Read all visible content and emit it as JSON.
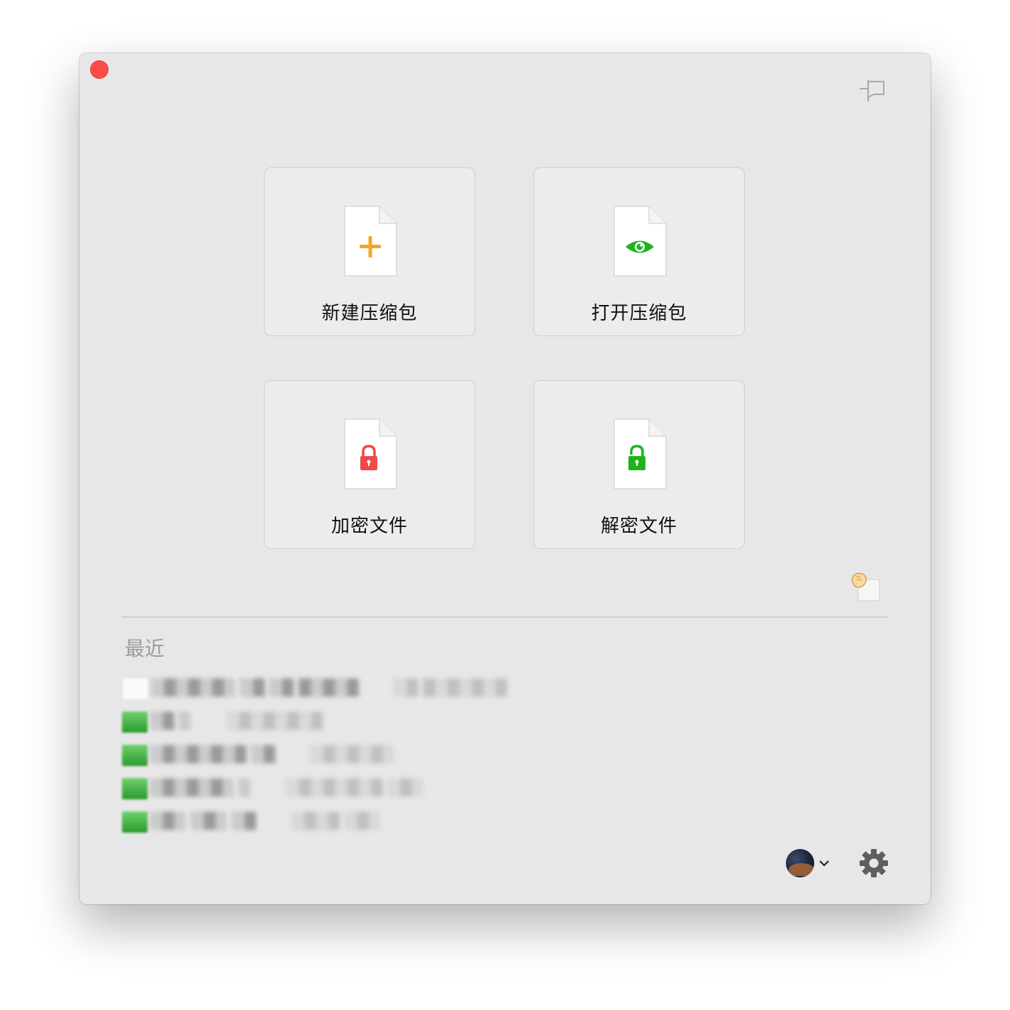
{
  "tiles": [
    {
      "label": "新建压缩包",
      "icon": "plus-icon",
      "color": "#f5a623"
    },
    {
      "label": "打开压缩包",
      "icon": "eye-icon",
      "color": "#1eb41e"
    },
    {
      "label": "加密文件",
      "icon": "locked-padlock-icon",
      "color": "#f14848"
    },
    {
      "label": "解密文件",
      "icon": "unlocked-padlock-icon",
      "color": "#1eb41e"
    }
  ],
  "recent": {
    "title": "最近",
    "items": [
      {
        "name": "░▒░▒░▒░ ░▒ ░▒ ▒░▒░▒",
        "path": "░▒ ▒░▒░▒░▒"
      },
      {
        "name": "░▒ ░",
        "path": "░▒░▒░▒░▒"
      },
      {
        "name": "░▒░▒░▒░▒ ░▒",
        "path": "░▒░▒░▒░"
      },
      {
        "name": "░▒░▒░▒░ ░",
        "path": "░▒░▒░▒░▒ ░▒░"
      },
      {
        "name": "░▒░ ░▒░ ░▒",
        "path": "░▒░▒ ░▒░"
      }
    ]
  },
  "colors": {
    "window_bg": "#e7e7e7",
    "close": "#fc4c4a",
    "accent_orange": "#f5a623",
    "accent_green": "#1eb41e",
    "accent_red": "#f14848"
  }
}
